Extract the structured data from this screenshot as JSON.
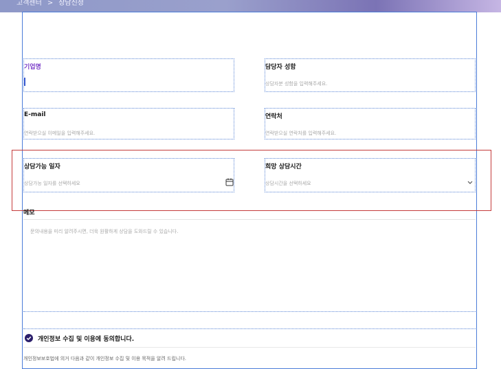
{
  "breadcrumb": {
    "home": "고객센터",
    "separator": ">",
    "current": "상담신청"
  },
  "form": {
    "company": {
      "label": "기업명",
      "placeholder": ""
    },
    "manager": {
      "label": "담당자 성함",
      "placeholder": "상담자분 성함을 입력해주세요."
    },
    "email": {
      "label": "E-mail",
      "placeholder": "연락받으실 이메일을 입력해주세요."
    },
    "phone": {
      "label": "연락처",
      "placeholder": "연락받으실 연락처를 입력해주세요."
    },
    "date": {
      "label": "상담가능 일자",
      "placeholder": "상담가능 일자를 선택하세요",
      "icon": "calendar-icon"
    },
    "time": {
      "label": "희망 상담시간",
      "placeholder": "상담시간을 선택하세요",
      "icon": "chevron-down-icon"
    },
    "memo": {
      "label": "메모",
      "placeholder": "문의내용을 미리 알려주시면, 더욱 원활하게 상담을 도와드릴 수 있습니다."
    },
    "agree": {
      "label": "개인정보 수집 및 이용에 동의합니다.",
      "checked": true,
      "icon": "check-circle-icon"
    },
    "notice": "개인정보보호법에 의거 다음과 같이 개인정보 수집 및 이용 목적을 알려 드립니다."
  },
  "colors": {
    "accent": "#2b1f6b",
    "label_active": "#7a3cc8",
    "selection_blue": "#4a7bd8",
    "highlight_red": "#c43a3a"
  }
}
